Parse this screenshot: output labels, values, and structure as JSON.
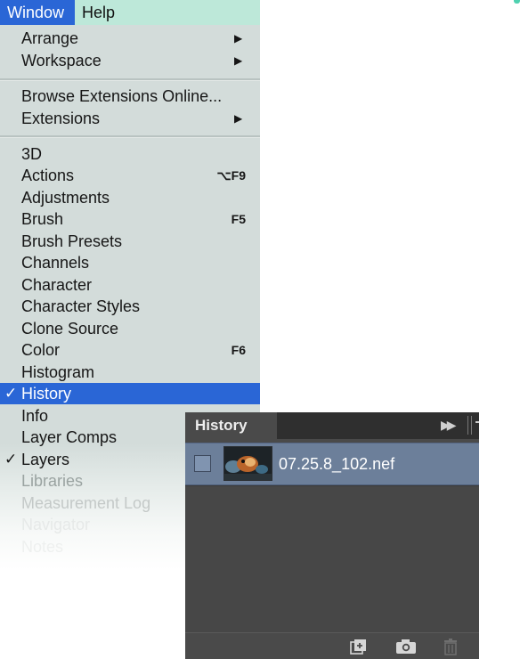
{
  "menubar": {
    "window_label": "Window",
    "help_label": "Help"
  },
  "menu": {
    "group1": [
      {
        "label": "Arrange",
        "submenu": true
      },
      {
        "label": "Workspace",
        "submenu": true
      }
    ],
    "group2": [
      {
        "label": "Browse Extensions Online..."
      },
      {
        "label": "Extensions",
        "submenu": true
      }
    ],
    "group3": [
      {
        "label": "3D",
        "shortcut": ""
      },
      {
        "label": "Actions",
        "shortcut": "⌥F9"
      },
      {
        "label": "Adjustments",
        "shortcut": ""
      },
      {
        "label": "Brush",
        "shortcut": "F5"
      },
      {
        "label": "Brush Presets",
        "shortcut": ""
      },
      {
        "label": "Channels",
        "shortcut": ""
      },
      {
        "label": "Character",
        "shortcut": ""
      },
      {
        "label": "Character Styles",
        "shortcut": ""
      },
      {
        "label": "Clone Source",
        "shortcut": ""
      },
      {
        "label": "Color",
        "shortcut": "F6"
      },
      {
        "label": "Histogram",
        "shortcut": ""
      },
      {
        "label": "History",
        "checked": true,
        "selected": true
      },
      {
        "label": "Info",
        "shortcut": ""
      },
      {
        "label": "Layer Comps",
        "shortcut": ""
      },
      {
        "label": "Layers",
        "checked": true
      },
      {
        "label": "Libraries",
        "shortcut": ""
      },
      {
        "label": "Measurement Log",
        "shortcut": ""
      },
      {
        "label": "Navigator",
        "shortcut": ""
      },
      {
        "label": "Notes",
        "shortcut": ""
      }
    ],
    "check_glyph": "✓",
    "arrow_glyph": "▶"
  },
  "history_panel": {
    "tab_label": "History",
    "collapse_glyph": "▶▶",
    "snapshot_label": "07.25.8_102.nef",
    "footer_icons": [
      "new-document-from-state-icon",
      "camera-icon",
      "trash-icon"
    ]
  },
  "colors": {
    "menubar_bg": "#bde8d9",
    "selection_blue": "#2a66d6",
    "menu_bg": "#d3dcda",
    "panel_bg": "#4a4a4a",
    "history_row_bg": "#6c7f9a"
  }
}
